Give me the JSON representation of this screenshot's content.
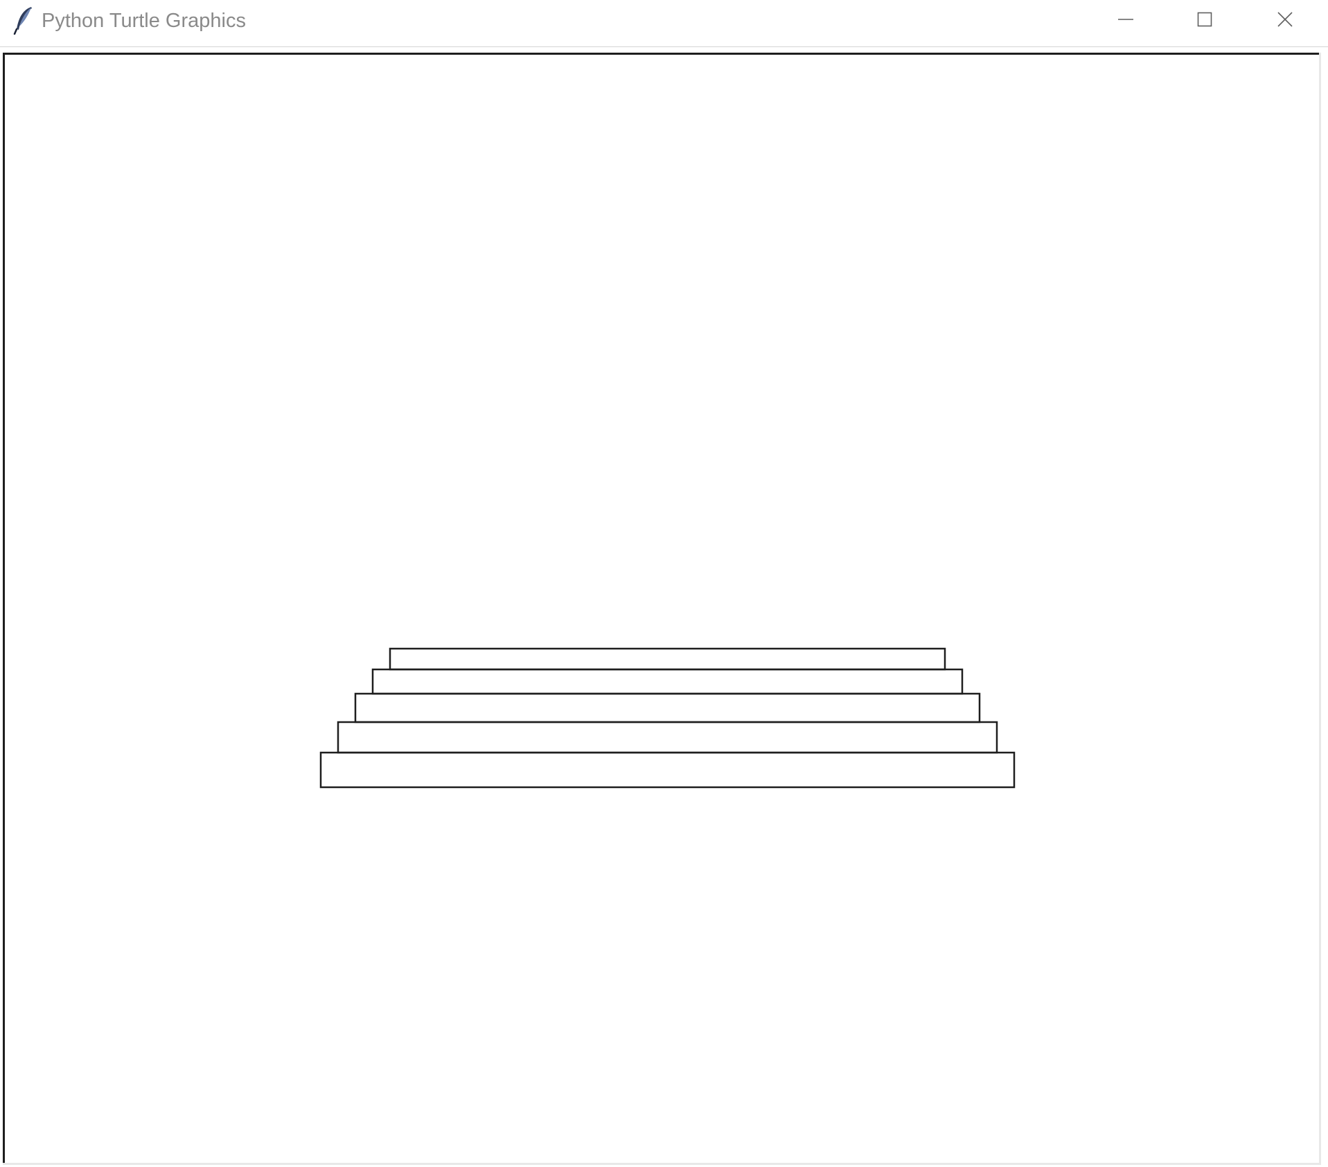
{
  "window": {
    "title": "Python Turtle Graphics",
    "app_icon": "feather-icon",
    "controls": [
      {
        "name": "minimize-button",
        "icon": "minimize-icon"
      },
      {
        "name": "maximize-button",
        "icon": "maximize-icon"
      },
      {
        "name": "close-button",
        "icon": "close-icon"
      }
    ]
  },
  "canvas": {
    "background": "#ffffff",
    "stroke_color": "#1e1e1e",
    "shapes": "stacked-steps-of-rectangles",
    "step_count": 5
  }
}
